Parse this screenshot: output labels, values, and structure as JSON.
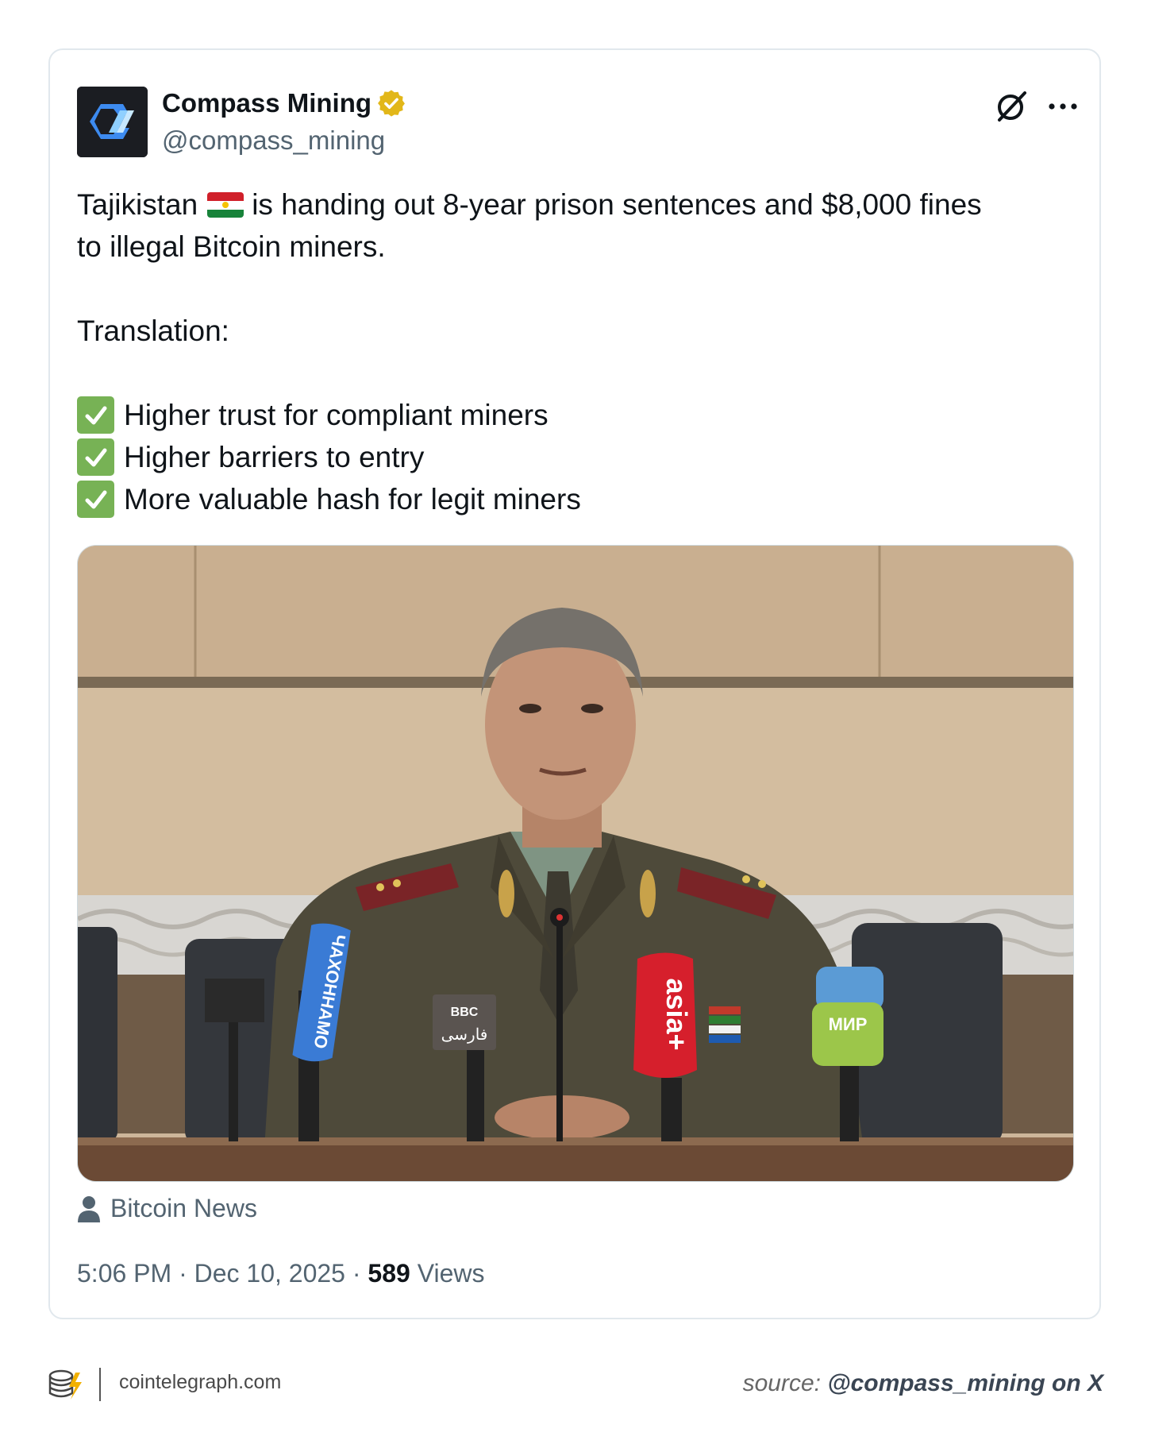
{
  "tweet": {
    "author_name": "Compass Mining",
    "author_handle": "@compass_mining",
    "lines": {
      "l1a": "Tajikistan",
      "l1b": "is handing out 8-year prison sentences and $8,000 fines",
      "l2": "to illegal Bitcoin miners.",
      "l3": "Translation:"
    },
    "checklist": [
      "Higher trust for compliant miners",
      "Higher barriers to entry",
      "More valuable hash for legit miners"
    ],
    "media_credit": "Bitcoin News",
    "time": "5:06 PM",
    "sep1": "·",
    "date": "Dec 10, 2025",
    "sep2": "·",
    "views_count": "589",
    "views_label": "Views",
    "mic_labels": {
      "mic1": "ЧАХОННАМО",
      "mic2_top": "BBC",
      "mic2_bottom": "فارسی",
      "mic3": "asia+",
      "mic4": "МИР"
    }
  },
  "icons": {
    "verified": "verified-badge-icon",
    "grok": "grok-icon",
    "more": "more-options-icon",
    "person": "person-icon",
    "check": "check-mark-icon",
    "flag": "tajikistan-flag-icon"
  },
  "colors": {
    "text_primary": "#0f1419",
    "text_secondary": "#536471",
    "verified_gold": "#e2b719",
    "check_green": "#77b255",
    "border": "#e1e8ed"
  },
  "footer": {
    "site": "cointelegraph.com",
    "source_prefix": "source:",
    "source_handle": "@compass_mining on X"
  }
}
